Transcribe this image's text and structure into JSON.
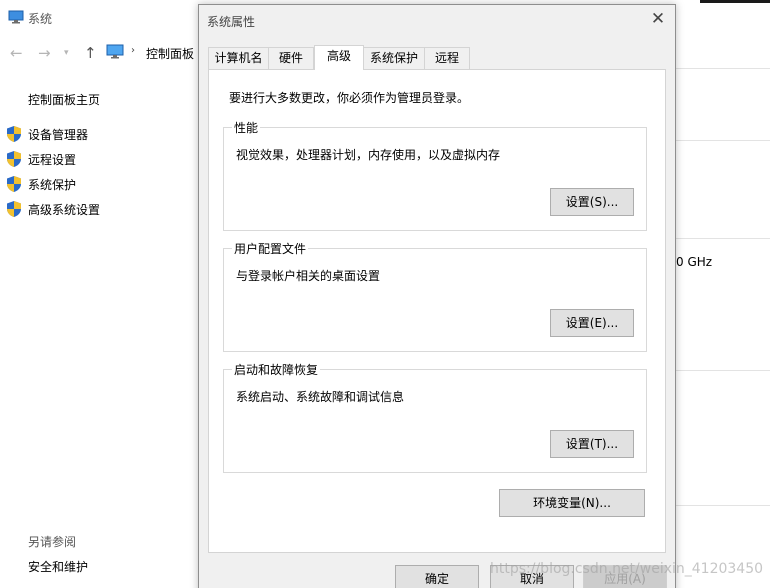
{
  "background_window": {
    "title": "系统",
    "breadcrumb": "控制面板",
    "home_link": "控制面板主页",
    "side_items": [
      {
        "label": "设备管理器",
        "icon": "shield-icon"
      },
      {
        "label": "远程设置",
        "icon": "shield-icon"
      },
      {
        "label": "系统保护",
        "icon": "shield-icon"
      },
      {
        "label": "高级系统设置",
        "icon": "shield-icon"
      }
    ],
    "see_also_label": "另请参阅",
    "security_link": "安全和维护",
    "cpu_speed_fragment": "0 GHz"
  },
  "dialog": {
    "title": "系统属性",
    "tabs": [
      {
        "label": "计算机名"
      },
      {
        "label": "硬件"
      },
      {
        "label": "高级",
        "active": true
      },
      {
        "label": "系统保护"
      },
      {
        "label": "远程"
      }
    ],
    "intro": "要进行大多数更改，你必须作为管理员登录。",
    "groups": [
      {
        "legend": "性能",
        "description": "视觉效果，处理器计划，内存使用，以及虚拟内存",
        "button": "设置(S)..."
      },
      {
        "legend": "用户配置文件",
        "description": "与登录帐户相关的桌面设置",
        "button": "设置(E)..."
      },
      {
        "legend": "启动和故障恢复",
        "description": "系统启动、系统故障和调试信息",
        "button": "设置(T)..."
      }
    ],
    "env_button": "环境变量(N)...",
    "footer": {
      "ok": "确定",
      "cancel": "取消",
      "apply": "应用(A)"
    }
  },
  "watermark": "https://blog.csdn.net/weixin_41203450",
  "colors": {
    "dialog_bg": "#f0f0f0",
    "panel_bg": "#ffffff",
    "button_bg": "#e1e1e1",
    "shield_blue": "#2a6ac7",
    "shield_yellow": "#f2c12e"
  }
}
